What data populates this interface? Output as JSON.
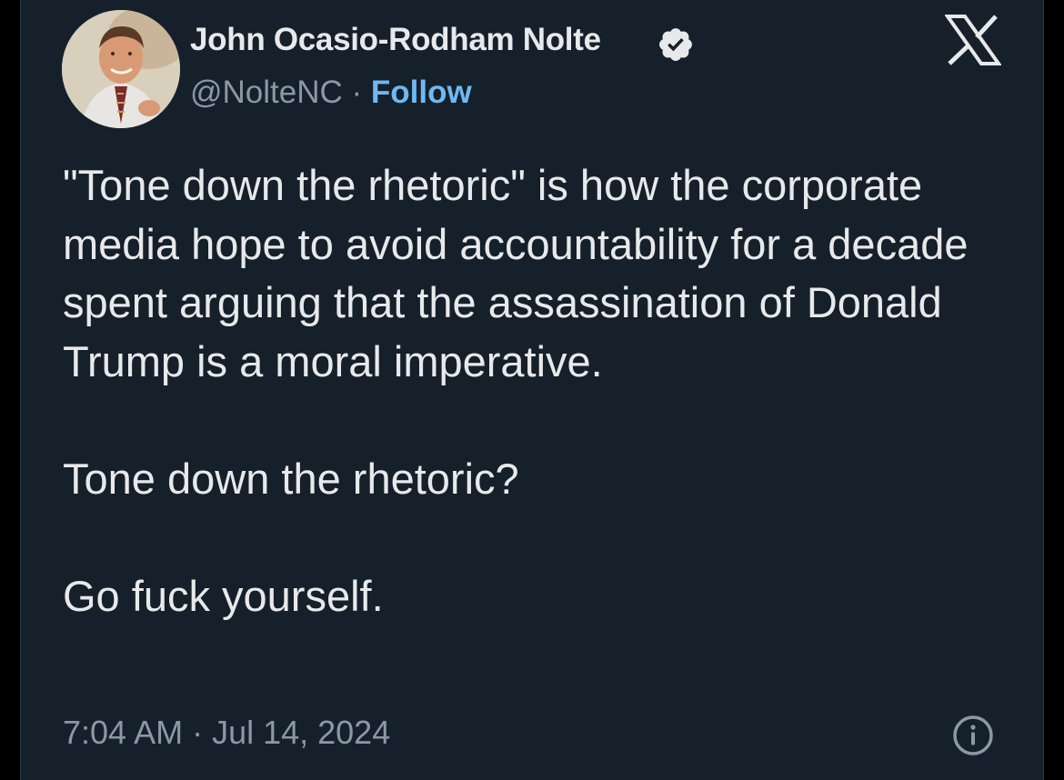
{
  "author": {
    "name": "John Ocasio-Rodham Nolte",
    "handle": "@NolteNC",
    "separator": "·",
    "follow_label": "Follow",
    "verified": true
  },
  "icons": {
    "avatar": "profile-photo",
    "verified": "verified-badge-icon",
    "platform": "x-logo-icon",
    "info": "info-icon"
  },
  "tweet": {
    "paragraphs": [
      "\"Tone down the rhetoric\" is how the corporate media hope to avoid accountability for a decade spent arguing that the assassination of Donald Trump is a moral imperative.",
      "Tone down the rhetoric?",
      "Go fuck yourself."
    ],
    "timestamp": "7:04 AM · Jul 14, 2024"
  },
  "colors": {
    "background": "#15202b",
    "text": "#e7e9ea",
    "secondary_text": "#8b98a5",
    "accent": "#6fb8f2"
  }
}
